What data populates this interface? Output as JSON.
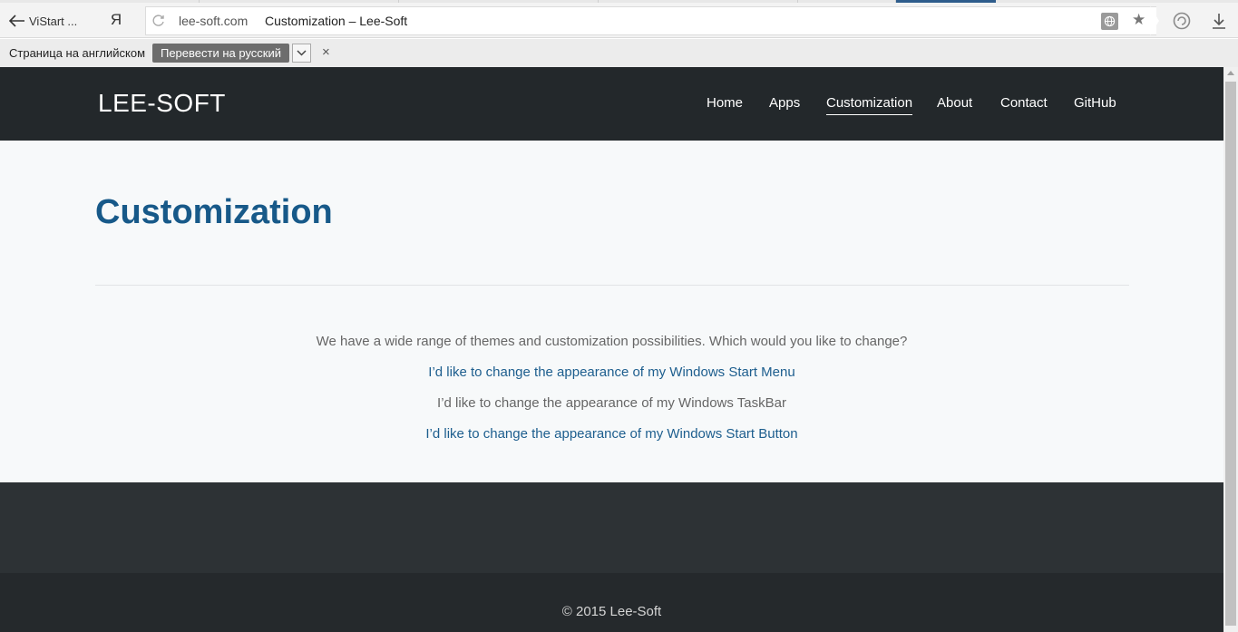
{
  "browser": {
    "back_label": "ViStart ...",
    "ya_label": "Я",
    "address": {
      "domain": "lee-soft.com",
      "title": "Customization – Lee-Soft"
    },
    "icons": [
      "reload-icon",
      "globe-icon",
      "star-icon",
      "sync-icon",
      "download-icon"
    ]
  },
  "translate_bar": {
    "label": "Страница на английском",
    "translate_button": "Перевести на русский",
    "close": "×"
  },
  "site": {
    "logo": "LEE-SOFT",
    "nav": [
      {
        "label": "Home"
      },
      {
        "label": "Apps"
      },
      {
        "label": "Customization",
        "active": true
      },
      {
        "label": "About"
      },
      {
        "label": "Contact"
      },
      {
        "label": "GitHub"
      }
    ]
  },
  "main": {
    "title": "Customization",
    "lines": [
      {
        "text": "We have a wide range of themes and customization possibilities. Which would you like to change?",
        "link": false
      },
      {
        "text": "I’d like to change the appearance of my Windows Start Menu",
        "link": true
      },
      {
        "text": "I’d like to change the appearance of my Windows TaskBar",
        "link": false
      },
      {
        "text": "I’d like to change the appearance of my Windows Start Button",
        "link": true
      }
    ]
  },
  "footer": {
    "copyright": "© 2015 Lee-Soft"
  },
  "colors": {
    "header_bg": "#23282b",
    "title": "#175989",
    "link": "#1d5e8e",
    "footer_bg": "#2d3235"
  }
}
